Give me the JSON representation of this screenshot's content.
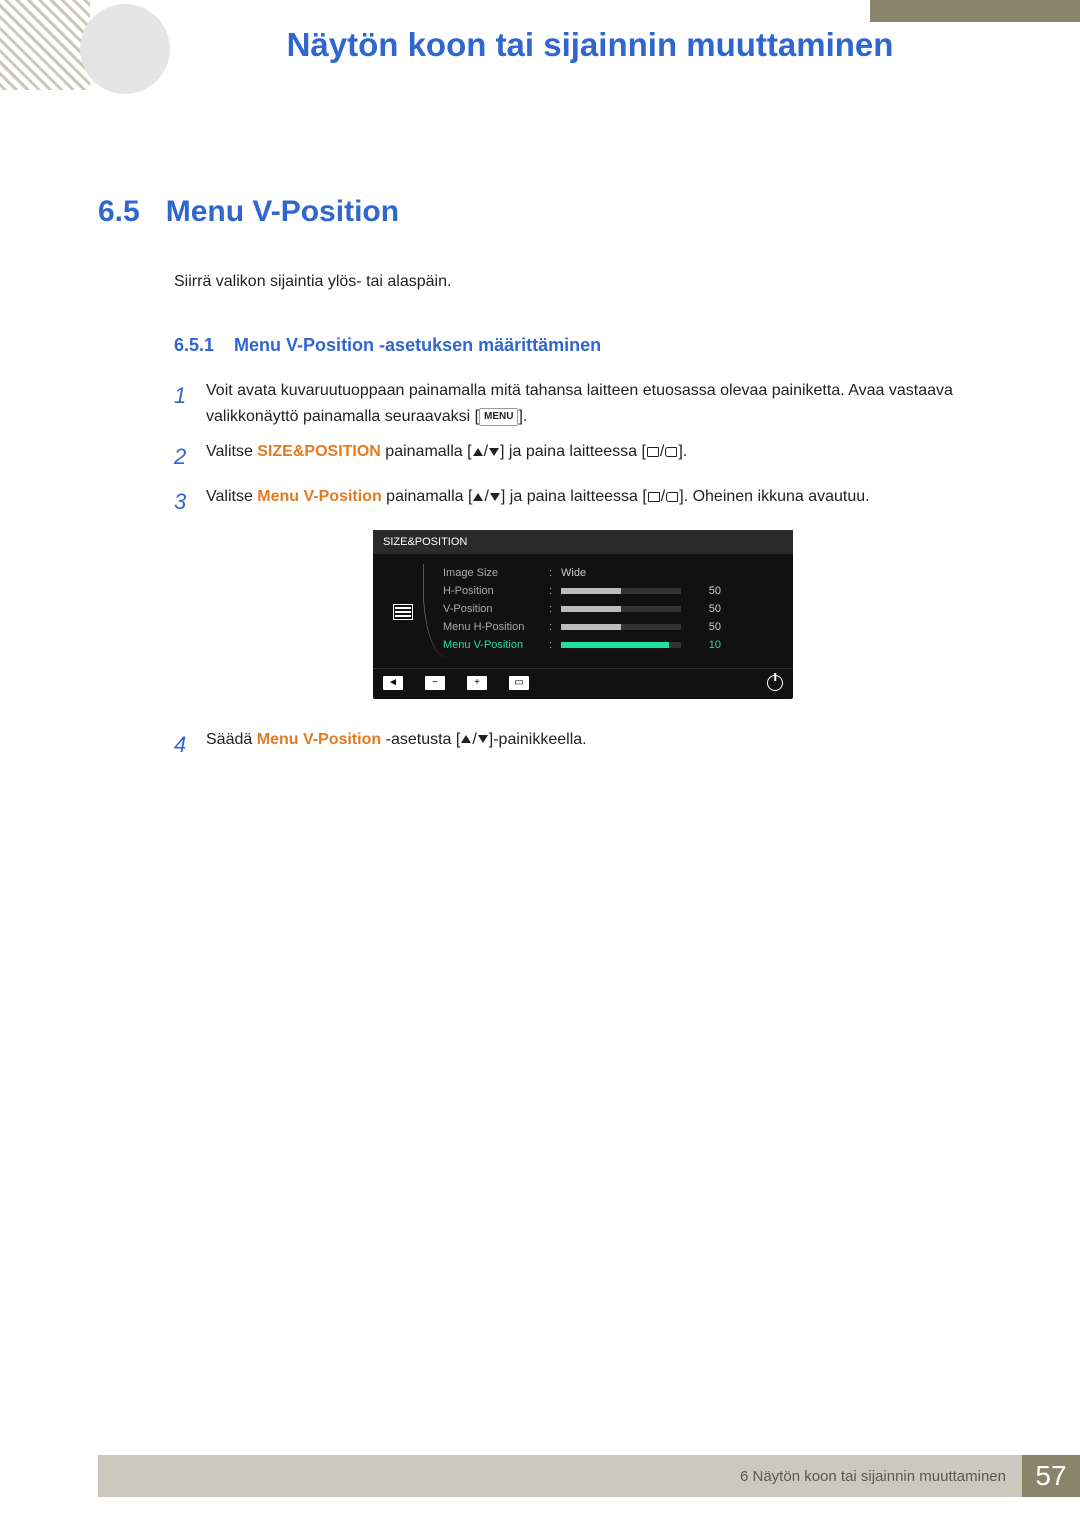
{
  "header": {
    "chapter_title": "Näytön koon tai sijainnin muuttaminen"
  },
  "section": {
    "number": "6.5",
    "title": "Menu V-Position",
    "intro": "Siirrä valikon sijaintia ylös- tai alaspäin."
  },
  "subsection": {
    "number": "6.5.1",
    "title": "Menu V-Position -asetuksen määrittäminen"
  },
  "steps": {
    "s1": {
      "num": "1",
      "a": "Voit avata kuvaruutuoppaan painamalla mitä tahansa laitteen etuosassa olevaa painiketta. Avaa vastaava valikkonäyttö painamalla seuraavaksi [",
      "menu_key": "MENU",
      "b": "]."
    },
    "s2": {
      "num": "2",
      "a": "Valitse ",
      "bold": "SIZE&POSITION",
      "b": " painamalla [",
      "c": "] ja paina laitteessa [",
      "d": "]."
    },
    "s3": {
      "num": "3",
      "a": "Valitse ",
      "bold": "Menu V-Position",
      "b": " painamalla [",
      "c": "] ja paina laitteessa [",
      "d": "]. Oheinen ikkuna avautuu."
    },
    "s4": {
      "num": "4",
      "a": "Säädä ",
      "bold": "Menu V-Position",
      "b": " -asetusta [",
      "c": "]-painikkeella."
    }
  },
  "osd": {
    "title": "SIZE&POSITION",
    "rows": {
      "r1": {
        "label": "Image Size",
        "value_text": "Wide"
      },
      "r2": {
        "label": "H-Position",
        "value": "50",
        "fill_pct": 50
      },
      "r3": {
        "label": "V-Position",
        "value": "50",
        "fill_pct": 50
      },
      "r4": {
        "label": "Menu H-Position",
        "value": "50",
        "fill_pct": 50
      },
      "r5": {
        "label": "Menu V-Position",
        "value": "10",
        "fill_pct": 90
      }
    },
    "footer_icons": {
      "b1": "◄",
      "b2": "−",
      "b3": "+",
      "b4": "▭"
    }
  },
  "footer": {
    "text": "6 Näytön koon tai sijainnin muuttaminen",
    "page": "57"
  }
}
